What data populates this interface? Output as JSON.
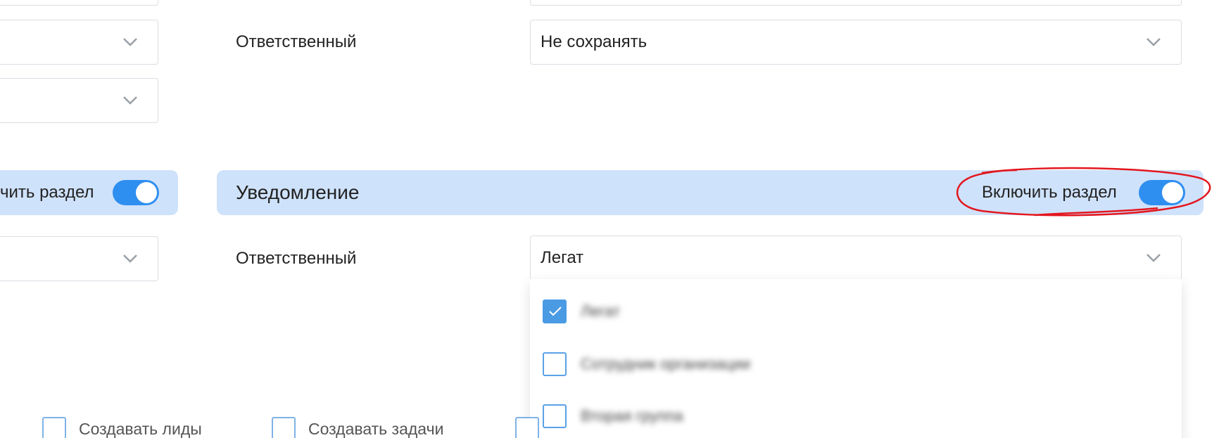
{
  "top_row": {
    "responsible_label": "Ответственный",
    "responsible_value": "Не сохранять"
  },
  "notification_section": {
    "title": "Уведомление",
    "enable_label": "Включить раздел",
    "enabled": true,
    "responsible_label": "Ответственный",
    "responsible_value": "Легат"
  },
  "left_section": {
    "enable_label_partial": "чить раздел",
    "enabled": true
  },
  "dropdown": {
    "items": [
      {
        "label": "Легат",
        "checked": true
      },
      {
        "label": "Сотрудник организации",
        "checked": false
      },
      {
        "label": "Вторая группа",
        "checked": false
      }
    ]
  },
  "options": {
    "create_leads": "Создавать лиды",
    "create_tasks": "Создавать задачи"
  },
  "colors": {
    "accent": "#2f8ff0",
    "band": "#cfe2fb",
    "annotation": "#e3161e"
  }
}
